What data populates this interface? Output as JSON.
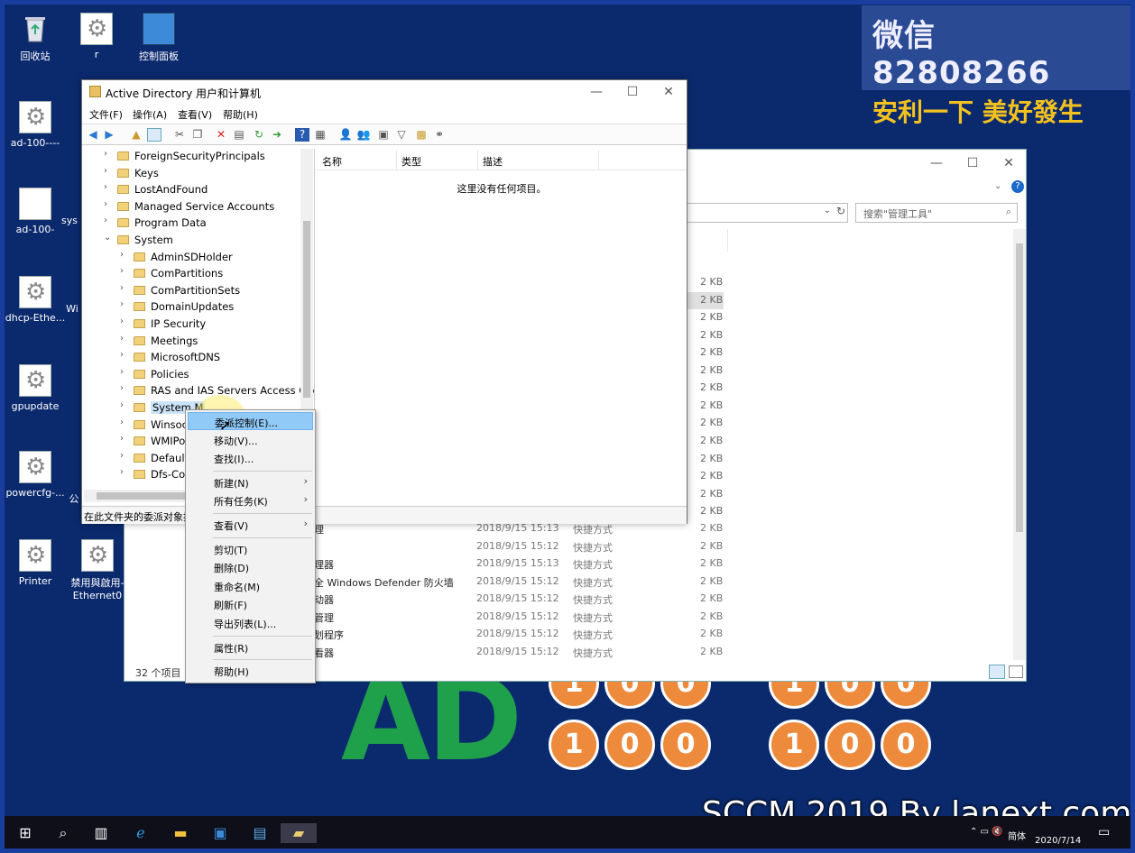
{
  "watermark": {
    "line1": "微信 82808266",
    "line2": "安利一下 美好發生"
  },
  "desktop_icons": [
    {
      "label": "回收站"
    },
    {
      "label": "r"
    },
    {
      "label": "控制面板"
    },
    {
      "label": "ad-100----"
    },
    {
      "label": "ad-100-"
    },
    {
      "label": "sys"
    },
    {
      "label": "dhcp-Ethe..."
    },
    {
      "label": "Wi"
    },
    {
      "label": "gpupdate"
    },
    {
      "label": "powercfg-..."
    },
    {
      "label": "公"
    },
    {
      "label": "Printer"
    },
    {
      "label": "禁用與啟用-Ethernet0"
    }
  ],
  "explorer": {
    "search_placeholder": "搜索\"管理工具\"",
    "status": "32 个项目",
    "size_col": [
      "2 KB",
      "2 KB",
      "2 KB",
      "2 KB",
      "2 KB",
      "2 KB",
      "2 KB",
      "2 KB",
      "2 KB",
      "2 KB",
      "2 KB",
      "2 KB",
      "2 KB",
      "2 KB"
    ],
    "rows": [
      {
        "name": "理",
        "date": "2018/9/15 15:13",
        "type": "快捷方式",
        "size": "2 KB"
      },
      {
        "name": "",
        "date": "2018/9/15 15:12",
        "type": "快捷方式",
        "size": "2 KB"
      },
      {
        "name": "理器",
        "date": "2018/9/15 15:13",
        "type": "快捷方式",
        "size": "2 KB"
      },
      {
        "name": "全 Windows Defender 防火墙",
        "date": "2018/9/15 15:12",
        "type": "快捷方式",
        "size": "2 KB"
      },
      {
        "name": "动器",
        "date": "2018/9/15 15:12",
        "type": "快捷方式",
        "size": "2 KB"
      },
      {
        "name": "管理",
        "date": "2018/9/15 15:12",
        "type": "快捷方式",
        "size": "2 KB"
      },
      {
        "name": "划程序",
        "date": "2018/9/15 15:12",
        "type": "快捷方式",
        "size": "2 KB"
      },
      {
        "name": "看器",
        "date": "2018/9/15 15:12",
        "type": "快捷方式",
        "size": "2 KB"
      }
    ]
  },
  "ad_window": {
    "title": "Active Directory 用户和计算机",
    "menu": [
      "文件(F)",
      "操作(A)",
      "查看(V)",
      "帮助(H)"
    ],
    "columns": [
      "名称",
      "类型",
      "描述"
    ],
    "empty_text": "这里没有任何项目。",
    "status": "在此文件夹的委派对象控",
    "tree": [
      {
        "label": "ForeignSecurityPrincipals",
        "level": 1
      },
      {
        "label": "Keys",
        "level": 1
      },
      {
        "label": "LostAndFound",
        "level": 1
      },
      {
        "label": "Managed Service Accounts",
        "level": 1
      },
      {
        "label": "Program Data",
        "level": 1
      },
      {
        "label": "System",
        "level": 1,
        "expanded": true
      },
      {
        "label": "AdminSDHolder",
        "level": 2
      },
      {
        "label": "ComPartitions",
        "level": 2
      },
      {
        "label": "ComPartitionSets",
        "level": 2
      },
      {
        "label": "DomainUpdates",
        "level": 2
      },
      {
        "label": "IP Security",
        "level": 2
      },
      {
        "label": "Meetings",
        "level": 2
      },
      {
        "label": "MicrosoftDNS",
        "level": 2
      },
      {
        "label": "Policies",
        "level": 2
      },
      {
        "label": "RAS and IAS Servers Access Che",
        "level": 2
      },
      {
        "label": "System M",
        "level": 2,
        "selected": true
      },
      {
        "label": "Winsock",
        "level": 2
      },
      {
        "label": "WMIPol",
        "level": 2
      },
      {
        "label": "Default",
        "level": 2
      },
      {
        "label": "Dfs-Con",
        "level": 2
      }
    ]
  },
  "context_menu": [
    {
      "label": "委派控制(E)...",
      "highlighted": true
    },
    {
      "label": "移动(V)..."
    },
    {
      "label": "查找(I)..."
    },
    {
      "sep": true
    },
    {
      "label": "新建(N)",
      "submenu": true
    },
    {
      "label": "所有任务(K)",
      "submenu": true
    },
    {
      "sep": true
    },
    {
      "label": "查看(V)",
      "submenu": true
    },
    {
      "sep": true
    },
    {
      "label": "剪切(T)"
    },
    {
      "label": "删除(D)"
    },
    {
      "label": "重命名(M)"
    },
    {
      "label": "刷新(F)"
    },
    {
      "label": "导出列表(L)..."
    },
    {
      "sep": true
    },
    {
      "label": "属性(R)"
    },
    {
      "sep": true
    },
    {
      "label": "帮助(H)"
    }
  ],
  "background_art": {
    "big_text": "AD",
    "digits": [
      "1",
      "0",
      "0",
      "1",
      "0",
      "0",
      "1",
      "0",
      "0",
      "1",
      "0",
      "0"
    ]
  },
  "overlay": {
    "text": "SCCM 2019 By lanext.com"
  },
  "taskbar": {
    "date": "2020/7/14",
    "ime": "简体"
  }
}
